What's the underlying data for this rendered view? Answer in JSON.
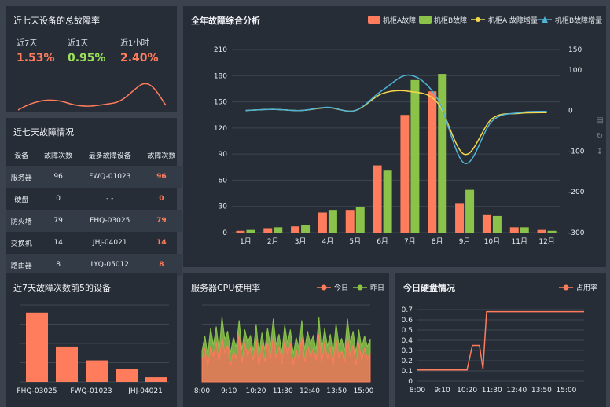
{
  "colors": {
    "orange": "#ff7c5c",
    "green": "#8bc34a",
    "yellow": "#f6d84b",
    "blue": "#4fb3d6",
    "panel": "#262d36"
  },
  "panel1": {
    "title": "近七天设备的总故障率",
    "stats": [
      {
        "label": "近7天",
        "value": "1.53%",
        "color": "#ff7c5c"
      },
      {
        "label": "近1天",
        "value": "0.95%",
        "color": "#9be05a"
      },
      {
        "label": "近1小时",
        "value": "2.40%",
        "color": "#ff7c5c"
      }
    ]
  },
  "panel2": {
    "title": "近七天故障情况",
    "headers": [
      "设备",
      "故障次数",
      "最多故障设备",
      "故障次数"
    ],
    "rows": [
      [
        "服务器",
        "96",
        "FWQ-01023",
        "96"
      ],
      [
        "硬盘",
        "0",
        "- -",
        "0"
      ],
      [
        "防火墙",
        "79",
        "FHQ-03025",
        "79"
      ],
      [
        "交换机",
        "14",
        "JHJ-04021",
        "14"
      ],
      [
        "路由器",
        "8",
        "LYQ-05012",
        "8"
      ]
    ]
  },
  "main_chart": {
    "title": "全年故障综合分析",
    "legend": [
      "机柜A故障",
      "机柜B故障",
      "机柜A 故障增量",
      "机柜B故障增量"
    ],
    "chart_data": {
      "type": "bar",
      "categories": [
        "1月",
        "2月",
        "3月",
        "4月",
        "5月",
        "6月",
        "7月",
        "8月",
        "9月",
        "10月",
        "11月",
        "12月"
      ],
      "series": [
        {
          "name": "机柜A故障",
          "type": "bar",
          "values": [
            2,
            5,
            7,
            23,
            26,
            77,
            135,
            162,
            33,
            20,
            6,
            3
          ]
        },
        {
          "name": "机柜B故障",
          "type": "bar",
          "values": [
            3,
            6,
            9,
            26,
            29,
            71,
            175,
            182,
            49,
            19,
            6,
            2
          ]
        },
        {
          "name": "机柜A 故障增量",
          "type": "line",
          "axis": "right",
          "values": [
            0,
            3,
            0,
            7,
            0,
            42,
            47,
            20,
            -108,
            -20,
            -7,
            -5
          ]
        },
        {
          "name": "机柜B故障增量",
          "type": "line",
          "axis": "right",
          "values": [
            0,
            3,
            0,
            8,
            0,
            50,
            87,
            30,
            -130,
            -26,
            -5,
            -2
          ]
        }
      ],
      "ylim": [
        0,
        210
      ],
      "yticks": [
        "0",
        "30",
        "60",
        "90",
        "120",
        "150",
        "180",
        "210"
      ],
      "y2lim": [
        -300,
        150
      ],
      "y2ticks": [
        "-300",
        "-200",
        "-100",
        "0",
        "100",
        "150"
      ]
    }
  },
  "toolbox": {
    "icons": [
      "data-view-icon",
      "restore-icon",
      "download-icon"
    ]
  },
  "panel3": {
    "title": "近7天故障次数前5的设备",
    "chart_data": {
      "type": "bar",
      "categories": [
        "FHQ-03025",
        "FWQ-01023",
        "JHJ-04021",
        "",
        ""
      ],
      "values": [
        90,
        46,
        28,
        17,
        6
      ]
    },
    "xlabels": [
      "FHQ-03025",
      "FWQ-01023",
      "JHJ-04021"
    ]
  },
  "panel4": {
    "title": "服务器CPU使用率",
    "legend": [
      "今日",
      "昨日"
    ],
    "xlabels": [
      "8:00",
      "9:10",
      "10:20",
      "11:30",
      "12:40",
      "13:50",
      "15:00"
    ],
    "chart_data": {
      "type": "area",
      "x": [
        "8:00",
        "9:10",
        "10:20",
        "11:30",
        "12:40",
        "13:50",
        "15:00"
      ],
      "series": [
        {
          "name": "今日",
          "values": [
            28,
            44,
            20,
            46,
            33,
            52,
            26,
            58,
            38,
            48,
            22,
            40,
            30,
            62,
            25,
            50,
            35,
            44,
            28,
            55,
            20,
            48,
            26,
            52,
            30,
            60,
            32,
            46,
            24,
            54,
            36,
            50,
            22,
            42,
            30,
            58,
            26,
            48,
            34,
            44,
            28,
            62,
            24,
            52,
            30,
            46,
            20,
            56,
            32,
            40,
            26,
            60,
            34,
            48,
            22,
            50,
            28,
            44,
            30,
            38
          ]
        },
        {
          "name": "昨日",
          "values": [
            40,
            60,
            35,
            70,
            48,
            72,
            40,
            85,
            55,
            66,
            38,
            58,
            45,
            80,
            42,
            68,
            52,
            60,
            40,
            75,
            36,
            64,
            42,
            70,
            46,
            82,
            48,
            62,
            38,
            74,
            50,
            68,
            36,
            58,
            44,
            80,
            42,
            66,
            50,
            60,
            42,
            84,
            40,
            70,
            46,
            62,
            36,
            76,
            48,
            56,
            40,
            82,
            50,
            66,
            38,
            68,
            44,
            60,
            46,
            55
          ]
        }
      ],
      "ylim": [
        0,
        100
      ]
    }
  },
  "panel5": {
    "title": "今日硬盘情况",
    "legend": [
      "占用率"
    ],
    "yticks": [
      "0",
      "0.1",
      "0.2",
      "0.3",
      "0.4",
      "0.5",
      "0.6",
      "0.7"
    ],
    "xlabels": [
      "8:00",
      "9:10",
      "10:20",
      "11:30",
      "12:40",
      "13:50",
      "15:00"
    ],
    "chart_data": {
      "type": "line",
      "series": [
        {
          "name": "占用率",
          "points": [
            [
              "8:00",
              0.11
            ],
            [
              "10:20",
              0.11
            ],
            [
              "10:35",
              0.35
            ],
            [
              "10:55",
              0.35
            ],
            [
              "11:05",
              0.12
            ],
            [
              "11:15",
              0.68
            ],
            [
              "15:50",
              0.68
            ]
          ]
        }
      ],
      "ylim": [
        0,
        0.7
      ]
    }
  }
}
